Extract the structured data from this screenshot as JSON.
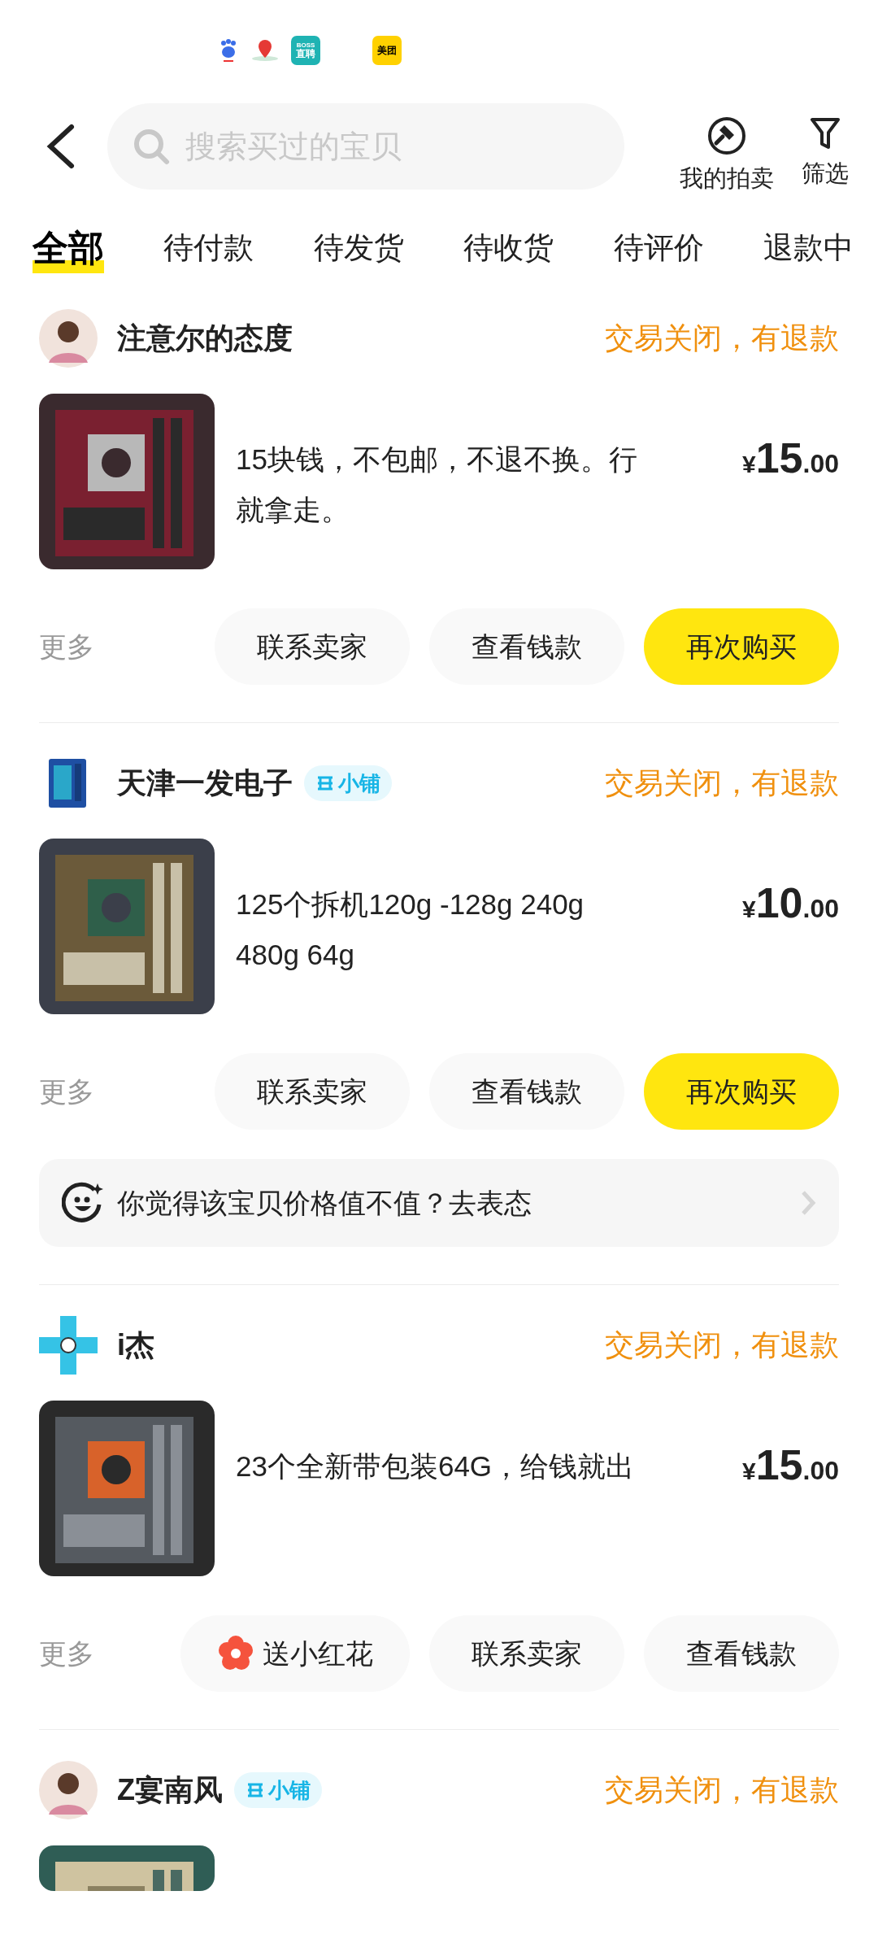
{
  "status_bar": {
    "apps": [
      {
        "kind": "baidu"
      },
      {
        "kind": "map"
      },
      {
        "kind": "boss",
        "label": "BOSS",
        "sublabel": "直聘"
      },
      {
        "kind": "meituan",
        "label": "美团"
      }
    ]
  },
  "header": {
    "search": {
      "placeholder": "搜索买过的宝贝"
    },
    "actions": [
      {
        "kind": "auction",
        "label": "我的拍卖"
      },
      {
        "kind": "filter",
        "label": "筛选"
      }
    ]
  },
  "tabs": [
    {
      "label": "全部",
      "selected": true
    },
    {
      "label": "待付款",
      "selected": false
    },
    {
      "label": "待发货",
      "selected": false
    },
    {
      "label": "待收货",
      "selected": false
    },
    {
      "label": "待评价",
      "selected": false
    },
    {
      "label": "退款中",
      "selected": false
    }
  ],
  "orders": [
    {
      "seller": "注意尔的态度",
      "avatar": {
        "kind": "person"
      },
      "status": "交易关闭，有退款",
      "title": "15块钱，不包邮，不退不换。行就拿走。",
      "price": {
        "symbol": "¥",
        "integer": "15",
        "decimal": ".00"
      },
      "more": "更多",
      "buttons": [
        {
          "kind": "plain",
          "label": "联系卖家"
        },
        {
          "kind": "plain",
          "label": "查看钱款"
        },
        {
          "kind": "primary",
          "label": "再次购买"
        }
      ]
    },
    {
      "seller": "天津一发电子",
      "avatar": {
        "kind": "cpu"
      },
      "badge": "小铺",
      "status": "交易关闭，有退款",
      "title": "125个拆机120g -128g 240g 480g 64g",
      "price": {
        "symbol": "¥",
        "integer": "10",
        "decimal": ".00"
      },
      "more": "更多",
      "buttons": [
        {
          "kind": "plain",
          "label": "联系卖家"
        },
        {
          "kind": "plain",
          "label": "查看钱款"
        },
        {
          "kind": "primary",
          "label": "再次购买"
        }
      ],
      "feedback": "你觉得该宝贝价格值不值？去表态"
    },
    {
      "seller": "i杰",
      "avatar": {
        "kind": "cross"
      },
      "status": "交易关闭，有退款",
      "title": "23个全新带包装64G，给钱就出",
      "price": {
        "symbol": "¥",
        "integer": "15",
        "decimal": ".00"
      },
      "more": "更多",
      "buttons": [
        {
          "kind": "flower",
          "label": "送小红花"
        },
        {
          "kind": "plain",
          "label": "联系卖家"
        },
        {
          "kind": "plain",
          "label": "查看钱款"
        }
      ]
    },
    {
      "seller": "Z宴南风",
      "avatar": {
        "kind": "person"
      },
      "badge": "小铺",
      "status": "交易关闭，有退款"
    }
  ]
}
